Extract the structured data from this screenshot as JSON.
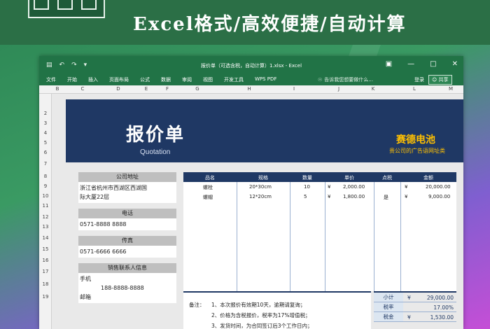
{
  "banner": {
    "title": "Excel格式/高效便捷/自动计算"
  },
  "titlebar": {
    "doc_title": "报价单（可选含税，自动计算）1.xlsx - Excel",
    "save_icon": "save-icon",
    "undo_icon": "undo-icon",
    "redo_icon": "redo-icon"
  },
  "ribbon": {
    "tabs": [
      "文件",
      "开始",
      "插入",
      "页面布局",
      "公式",
      "数据",
      "审阅",
      "视图",
      "开发工具",
      "WPS PDF"
    ],
    "tell_me": "告诉我您想要做什么...",
    "login": "登录",
    "share": "共享"
  },
  "columns": [
    "B",
    "C",
    "D",
    "E",
    "F",
    "G",
    "H",
    "I",
    "J",
    "K",
    "L",
    "M"
  ],
  "rows": [
    "1",
    "2",
    "3",
    "4",
    "5",
    "6",
    "7",
    "8",
    "9",
    "10",
    "11",
    "12",
    "13",
    "14",
    "15",
    "16",
    "17",
    "18",
    "19"
  ],
  "quote": {
    "title": "报价单",
    "subtitle": "Quotation",
    "company": "赛德电池",
    "company_sub": "贵公司的广告语网址类"
  },
  "left": {
    "addr_label": "公司地址",
    "addr_value1": "浙江省杭州市西湖区西湖国",
    "addr_value2": "际大厦22层",
    "phone_label": "电话",
    "phone_value": "0571-8888 8888",
    "fax_label": "传真",
    "fax_value": "0571-6666 6666",
    "sales_label": "销售联系人信息",
    "mobile_label": "手机",
    "mobile_value": "188-8888-8888",
    "email_label": "邮箱"
  },
  "table": {
    "headers": [
      "品名",
      "规格",
      "数量",
      "单价",
      "点税",
      "金额"
    ],
    "rows": [
      {
        "name": "螺栓",
        "spec": "20*30cm",
        "qty": "10",
        "cur1": "¥",
        "price": "2,000.00",
        "tax": "",
        "cur2": "¥",
        "amount": "20,000.00"
      },
      {
        "name": "螺帽",
        "spec": "12*20cm",
        "qty": "5",
        "cur1": "¥",
        "price": "1,800.00",
        "tax": "是",
        "cur2": "¥",
        "amount": "9,000.00"
      }
    ]
  },
  "notes": {
    "label": "备注：",
    "items": [
      "1、本次报价有效期10天，逾期请复询；",
      "2、价格为含税报价，税率为17%增值税；",
      "3、发货时间，为合同签订后3个工作日内；"
    ]
  },
  "totals": [
    {
      "k": "小计",
      "cur": "¥",
      "v": "29,000.00"
    },
    {
      "k": "税率",
      "cur": "",
      "v": "17.00%"
    },
    {
      "k": "税金",
      "cur": "¥",
      "v": "1,530.00"
    }
  ]
}
